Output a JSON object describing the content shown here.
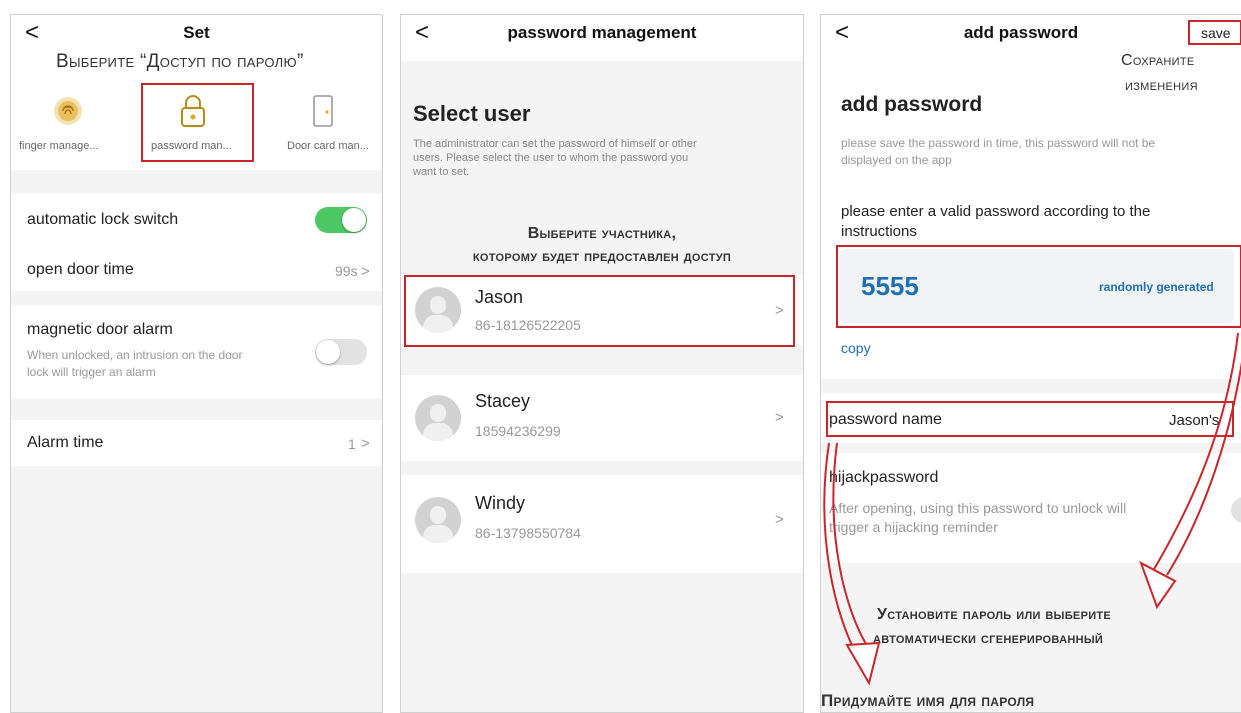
{
  "panel1": {
    "back": "<",
    "title": "Set",
    "annotation": "Выберите “Доступ по паролю”",
    "icons": [
      {
        "label": "finger manage...",
        "icon": "fingerprint-icon"
      },
      {
        "label": "password man...",
        "icon": "lock-icon"
      },
      {
        "label": "Door card man...",
        "icon": "door-card-icon"
      }
    ],
    "auto_lock": {
      "label": "automatic lock switch",
      "on": true
    },
    "open_door": {
      "label": "open door time",
      "value": "99s",
      "chevron": ">"
    },
    "magnetic": {
      "label": "magnetic door alarm",
      "desc1": "When unlocked, an intrusion on the door",
      "desc2": "lock will trigger an alarm",
      "on": false
    },
    "alarm_time": {
      "label": "Alarm time",
      "value": "1",
      "chevron": ">"
    }
  },
  "panel2": {
    "back": "<",
    "title": "password management",
    "heading": "Select user",
    "desc1": "The administrator can set the password of himself or other",
    "desc2": "users. Please select the user to whom the password you",
    "desc3": "want to set.",
    "annotation1": "Выберите участника,",
    "annotation2": "которому будет предоставлен доступ",
    "users": [
      {
        "name": "Jason",
        "phone": "86-18126522205"
      },
      {
        "name": "Stacey",
        "phone": "18594236299"
      },
      {
        "name": "Windy",
        "phone": "86-13798550784"
      }
    ],
    "chevron": ">"
  },
  "panel3": {
    "back": "<",
    "title": "add password",
    "save": "save",
    "annotation_save1": "Сохраните",
    "annotation_save2": "изменения",
    "heading": "add password",
    "note1": "please save the password in time, this password will not be",
    "note2": "displayed on the app",
    "prompt1": "please enter a valid password according to the",
    "prompt2": "instructions",
    "password": "5555",
    "random": "randomly generated",
    "copy": "copy",
    "name_label": "password name",
    "name_value": "Jason's",
    "hijack_title": "hijackpassword",
    "hijack_desc1": "After opening, using this password to unlock will",
    "hijack_desc2": "trigger a hijacking reminder",
    "annotation_set1": "Установите пароль или выберите",
    "annotation_set2": "автоматически сгенерированный",
    "annotation_name": "Придумайте имя для пароля"
  },
  "colors": {
    "accent_red": "#c9262c",
    "toggle_on": "#4cc764",
    "link_blue": "#1e6fb8"
  }
}
